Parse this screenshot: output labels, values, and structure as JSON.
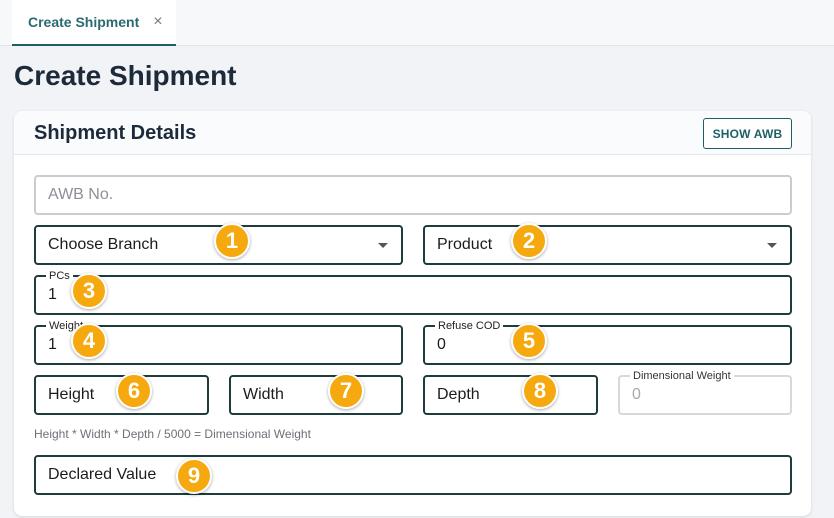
{
  "tab": {
    "label": "Create Shipment",
    "close_glyph": "×"
  },
  "page": {
    "title": "Create Shipment"
  },
  "card": {
    "title": "Shipment Details",
    "show_awb_label": "SHOW AWB"
  },
  "fields": {
    "awb": {
      "placeholder": "AWB No."
    },
    "branch": {
      "value": "Choose Branch"
    },
    "product": {
      "value": "Product"
    },
    "pcs": {
      "label": "PCs",
      "value": "1"
    },
    "weight": {
      "label": "Weight",
      "value": "1"
    },
    "refuse_cod": {
      "label": "Refuse COD",
      "value": "0"
    },
    "height": {
      "value": "Height"
    },
    "width": {
      "value": "Width"
    },
    "depth": {
      "value": "Depth"
    },
    "dim_weight": {
      "label": "Dimensional Weight",
      "value": "0"
    },
    "declared_value": {
      "value": "Declared Value"
    }
  },
  "hint": "Height * Width * Depth / 5000 = Dimensional Weight",
  "badges": [
    "1",
    "2",
    "3",
    "4",
    "5",
    "6",
    "7",
    "8",
    "9"
  ],
  "colors": {
    "accent": "#1e5f66",
    "badge": "#f5a90e"
  }
}
